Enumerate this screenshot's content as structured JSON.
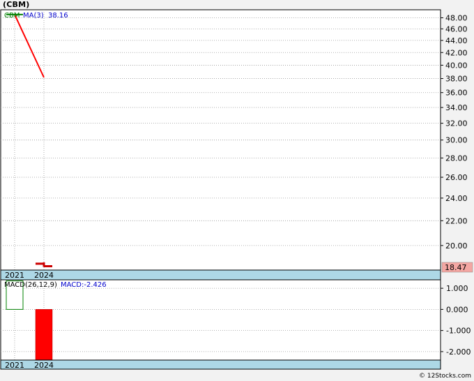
{
  "ticker": "(CBM)",
  "credit": "© 12Stocks.com",
  "colors": {
    "background": "#f2f2f2",
    "plot_bg": "#ffffff",
    "grid": "#999999",
    "axis_band": "#add8e6",
    "price_line": "#008000",
    "ma_line": "#ff0000",
    "macd_pos_outline": "#008000",
    "macd_neg_fill": "#ff0000",
    "last_price_box": "#f4a7a3"
  },
  "price_panel": {
    "legend": {
      "series": "CBM",
      "ma_label": "MA(3)",
      "ma_value": "38.16"
    },
    "last_price_label": "18.47"
  },
  "macd_panel": {
    "legend": {
      "params": "MACD(26,12,9)",
      "value_label": "MACD:-2.426"
    }
  },
  "chart_data": [
    {
      "type": "line",
      "title": "(CBM)",
      "x": [
        "2021",
        "2024"
      ],
      "log_scale": true,
      "ylim": [
        18.2,
        49.5
      ],
      "yticks": [
        "20.00",
        "22.00",
        "24.00",
        "26.00",
        "28.00",
        "30.00",
        "32.00",
        "34.00",
        "36.00",
        "38.00",
        "40.00",
        "42.00",
        "44.00",
        "46.00",
        "48.00"
      ],
      "grid": true,
      "series": [
        {
          "name": "CBM",
          "style": "ohlc",
          "points": [
            {
              "x": "2021",
              "open": 48.6,
              "high": 48.6,
              "low": 48.6,
              "close": 48.6
            },
            {
              "x": "2024",
              "open": 18.65,
              "high": 18.75,
              "low": 18.47,
              "close": 18.47
            }
          ]
        },
        {
          "name": "MA(3)",
          "style": "line",
          "points": [
            {
              "x": "2021",
              "y": 48.6
            },
            {
              "x": "2024",
              "y": 38.16
            }
          ]
        }
      ]
    },
    {
      "type": "bar",
      "title": "MACD(26,12,9)",
      "categories": [
        "2021",
        "2024"
      ],
      "values": [
        1.35,
        -2.426
      ],
      "ylim": [
        -2.4,
        1.4
      ],
      "yticks": [
        "1.000",
        "0.000",
        "-1.000",
        "-2.000"
      ],
      "grid": true
    }
  ]
}
